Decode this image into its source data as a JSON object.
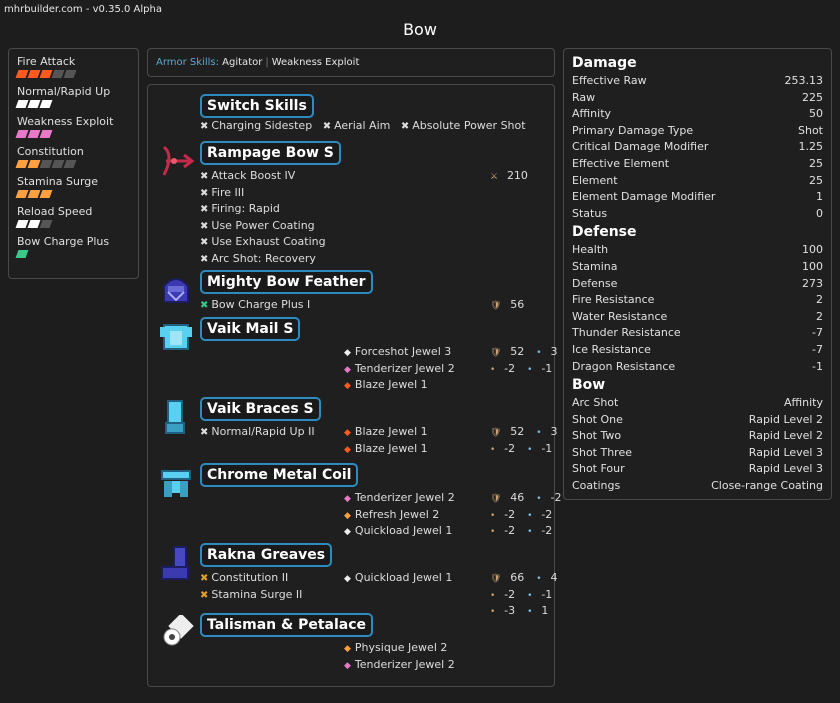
{
  "site": {
    "label": "mhrbuilder.com - v0.35.0 Alpha"
  },
  "page_title": "Bow",
  "skills": [
    {
      "name": "Fire Attack",
      "pips": [
        "#ff5a1f",
        "#ff5a1f",
        "#ff5a1f",
        "#555",
        "#555"
      ]
    },
    {
      "name": "Normal/Rapid Up",
      "pips": [
        "#ffffff",
        "#ffffff",
        "#ffffff"
      ]
    },
    {
      "name": "Weakness Exploit",
      "pips": [
        "#e879c8",
        "#e879c8",
        "#e879c8"
      ]
    },
    {
      "name": "Constitution",
      "pips": [
        "#ffa040",
        "#ffa040",
        "#555",
        "#555",
        "#555"
      ]
    },
    {
      "name": "Stamina Surge",
      "pips": [
        "#ffa040",
        "#ffa040",
        "#ffa040"
      ]
    },
    {
      "name": "Reload Speed",
      "pips": [
        "#ffffff",
        "#ffffff",
        "#555"
      ]
    },
    {
      "name": "Bow Charge Plus",
      "pips": [
        "#3cc88a"
      ]
    }
  ],
  "armor_skills": {
    "label": "Armor Skills:",
    "values": [
      "Agitator",
      "Weakness Exploit"
    ]
  },
  "weapon_switch": {
    "title": "Switch Skills",
    "items": [
      "Charging Sidestep",
      "Aerial Aim",
      "Absolute Power Shot"
    ]
  },
  "equipment": [
    {
      "id": "weapon",
      "name": "Rampage Bow S",
      "skills": [
        "Attack Boost IV",
        "Fire III",
        "Firing: Rapid",
        "Use Power Coating",
        "Use Exhaust Coating",
        "Arc Shot: Recovery"
      ],
      "skill_color": "x",
      "jewels": [],
      "stats_line1": [
        "210"
      ],
      "stats_line2": [],
      "stats_line3": []
    },
    {
      "id": "head",
      "name": "Mighty Bow Feather",
      "skills": [
        "Bow Charge Plus I"
      ],
      "skill_color": "xg",
      "jewels": [],
      "stats_line1": [
        "56"
      ],
      "stats_line2": [],
      "stats_line3": []
    },
    {
      "id": "chest",
      "name": "Vaik Mail S",
      "skills": [],
      "skill_color": "x",
      "jewels": [
        {
          "name": "Forceshot Jewel 3",
          "color": "#eeeeee"
        },
        {
          "name": "Tenderizer Jewel 2",
          "color": "#e879c8"
        },
        {
          "name": "Blaze Jewel 1",
          "color": "#ff5a1f"
        }
      ],
      "stats_line1": [
        "52",
        "3"
      ],
      "stats_line2": [
        "-2",
        "-1"
      ],
      "stats_line3": []
    },
    {
      "id": "arms",
      "name": "Vaik Braces S",
      "skills": [
        "Normal/Rapid Up II"
      ],
      "skill_color": "x",
      "jewels": [
        {
          "name": "Blaze Jewel 1",
          "color": "#ff5a1f"
        },
        {
          "name": "Blaze Jewel 1",
          "color": "#ff5a1f"
        }
      ],
      "stats_line1": [
        "52",
        "3"
      ],
      "stats_line2": [
        "-2",
        "-1"
      ],
      "stats_line3": []
    },
    {
      "id": "waist",
      "name": "Chrome Metal Coil",
      "skills": [],
      "skill_color": "x",
      "jewels": [
        {
          "name": "Tenderizer Jewel 2",
          "color": "#e879c8"
        },
        {
          "name": "Refresh Jewel 2",
          "color": "#ffa040"
        },
        {
          "name": "Quickload Jewel 1",
          "color": "#eeeeee"
        }
      ],
      "stats_line1": [
        "46",
        "-2"
      ],
      "stats_line2": [
        "-2",
        "-2"
      ],
      "stats_line3": [
        "-2",
        "-2"
      ]
    },
    {
      "id": "legs",
      "name": "Rakna Greaves",
      "skills": [
        "Constitution II",
        "Stamina Surge II"
      ],
      "skill_color": "xo",
      "jewels": [
        {
          "name": "Quickload Jewel 1",
          "color": "#eeeeee"
        }
      ],
      "stats_line1": [
        "66",
        "4"
      ],
      "stats_line2": [
        "-2",
        "-1"
      ],
      "stats_line3": [
        "-3",
        "1"
      ]
    },
    {
      "id": "talisman",
      "name": "Talisman & Petalace",
      "skills": [],
      "skill_color": "x",
      "jewels": [
        {
          "name": "Physique Jewel 2",
          "color": "#ffa040"
        },
        {
          "name": "Tenderizer Jewel 2",
          "color": "#e879c8"
        }
      ],
      "stats_line1": [],
      "stats_line2": [],
      "stats_line3": []
    }
  ],
  "damage": {
    "title": "Damage",
    "rows": [
      {
        "k": "Effective Raw",
        "v": "253.13"
      },
      {
        "k": "Raw",
        "v": "225"
      },
      {
        "k": "Affinity",
        "v": "50"
      },
      {
        "k": "Primary Damage Type",
        "v": "Shot"
      },
      {
        "k": "Critical Damage Modifier",
        "v": "1.25"
      },
      {
        "k": "Effective Element",
        "v": "25"
      },
      {
        "k": "Element",
        "v": "25"
      },
      {
        "k": "Element Damage Modifier",
        "v": "1"
      },
      {
        "k": "Status",
        "v": "0"
      }
    ]
  },
  "defense": {
    "title": "Defense",
    "rows": [
      {
        "k": "Health",
        "v": "100"
      },
      {
        "k": "Stamina",
        "v": "100"
      },
      {
        "k": "Defense",
        "v": "273"
      },
      {
        "k": "Fire Resistance",
        "v": "2"
      },
      {
        "k": "Water Resistance",
        "v": "2"
      },
      {
        "k": "Thunder Resistance",
        "v": "-7"
      },
      {
        "k": "Ice Resistance",
        "v": "-7"
      },
      {
        "k": "Dragon Resistance",
        "v": "-1"
      }
    ]
  },
  "bow": {
    "title": "Bow",
    "rows": [
      {
        "k": "Arc Shot",
        "v": "Affinity"
      },
      {
        "k": "Shot One",
        "v": "Rapid Level 2"
      },
      {
        "k": "Shot Two",
        "v": "Rapid Level 2"
      },
      {
        "k": "Shot Three",
        "v": "Rapid Level 3"
      },
      {
        "k": "Shot Four",
        "v": "Rapid Level 3"
      },
      {
        "k": "Coatings",
        "v": "Close-range Coating"
      }
    ]
  }
}
